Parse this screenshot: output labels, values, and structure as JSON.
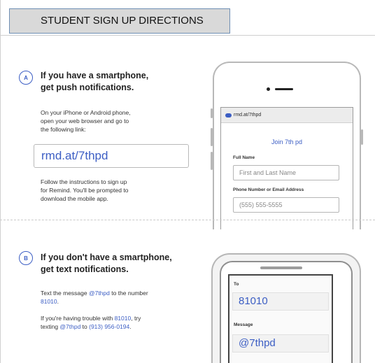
{
  "header": {
    "title": "STUDENT SIGN UP DIRECTIONS"
  },
  "stepA": {
    "badge": "A",
    "title_line1": "If you have a smartphone,",
    "title_line2": "get push notifications.",
    "instr": [
      "On your iPhone or Android phone,",
      "open your web browser and go to",
      "the following link:"
    ],
    "link": "rmd.at/7thpd",
    "follow": [
      "Follow the instructions to sign up",
      "for Remind. You'll be prompted to",
      "download the mobile app."
    ]
  },
  "phoneA": {
    "url": "rmd.at/7thpd",
    "join_title": "Join 7th pd",
    "full_name_label": "Full Name",
    "full_name_placeholder": "First and Last Name",
    "contact_label": "Phone Number or Email Address",
    "contact_placeholder": "(555) 555-5555"
  },
  "stepB": {
    "badge": "B",
    "title_pre": "If you ",
    "title_bold": "don't",
    "title_post": " have a smartphone,",
    "title_line2": "get text notifications.",
    "text_pre": "Text the message ",
    "text_code": "@7thpd",
    "text_mid": " to the number",
    "text_number": "81010",
    "text_end": ".",
    "trouble_pre": "If you're having trouble with ",
    "trouble_number": "81010",
    "trouble_mid": ", try",
    "trouble_texting": "texting ",
    "trouble_code": "@7thpd",
    "trouble_to": " to ",
    "trouble_alt": "(913) 956-0194",
    "trouble_end": "."
  },
  "phoneB": {
    "to_label": "To",
    "to_value": "81010",
    "message_label": "Message",
    "message_value": "@7thpd"
  },
  "colors": {
    "accent": "#3c5ec4",
    "header_bg": "#d9d9d9",
    "header_border": "#6f8fb4"
  }
}
